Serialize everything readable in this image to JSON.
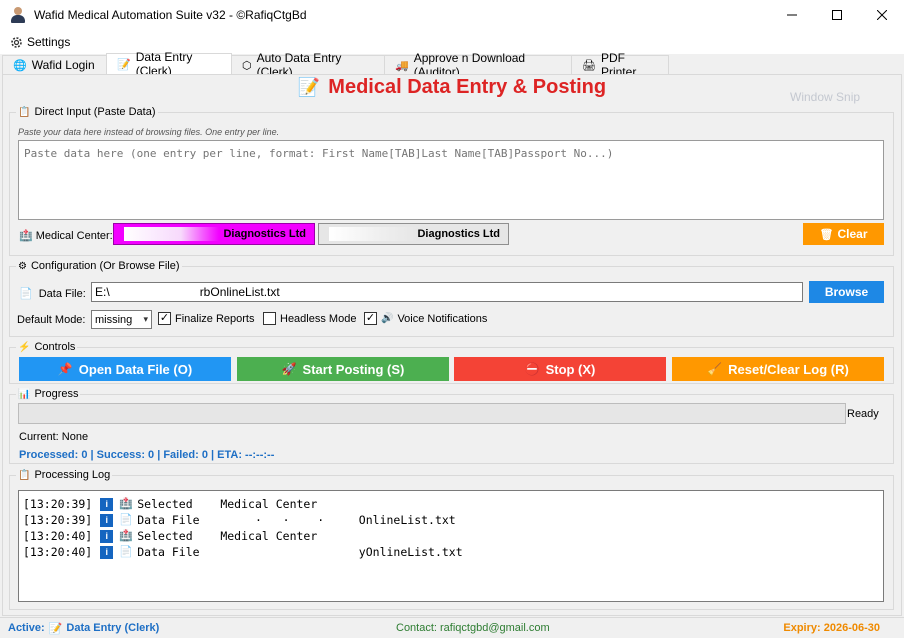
{
  "window": {
    "title": "Wafid Medical Automation Suite v32 - ©RafiqCtgBd",
    "controls": [
      "minimize-icon",
      "maximize-icon",
      "close-icon"
    ]
  },
  "menu": {
    "settings_label": "Settings"
  },
  "tabs": [
    {
      "label": "Wafid Login",
      "icon": "globe-icon",
      "active": false
    },
    {
      "label": "Data Entry (Clerk)",
      "icon": "notepad-icon",
      "active": true
    },
    {
      "label": "Auto Data Entry (Clerk)",
      "icon": "cube-icon",
      "active": false
    },
    {
      "label": "Approve n Download (Auditor)",
      "icon": "truck-icon",
      "active": false
    },
    {
      "label": "PDF Printer",
      "icon": "printer-icon",
      "active": false
    }
  ],
  "header": {
    "title": "Medical Data Entry & Posting"
  },
  "overlay": {
    "ghost_text": "Window Snip"
  },
  "direct_input": {
    "legend": "Direct Input (Paste Data)",
    "hint": "Paste your data here instead of browsing files. One entry per line.",
    "placeholder": "Paste data here (one entry per line, format: First Name[TAB]Last Name[TAB]Passport No...)",
    "medical_center_label": "Medical Center:",
    "center_1": "Diagnostics Ltd",
    "center_2": "Diagnostics Ltd",
    "clear_label": "Clear"
  },
  "config": {
    "legend": "Configuration (Or Browse File)",
    "data_file_label": "Data File:",
    "data_file_value": "E:\\                           rbOnlineList.txt",
    "browse_label": "Browse",
    "default_mode_label": "Default Mode:",
    "default_mode_value": "missing",
    "finalize_reports": {
      "label": "Finalize Reports",
      "checked": true
    },
    "headless_mode": {
      "label": "Headless Mode",
      "checked": false
    },
    "voice_notifications": {
      "label": "Voice Notifications",
      "checked": true
    }
  },
  "controls": {
    "legend": "Controls",
    "open_label": "Open Data File (O)",
    "start_label": "Start Posting (S)",
    "stop_label": "Stop (X)",
    "reset_label": "Reset/Clear Log (R)",
    "colors": {
      "open": "#2196f3",
      "start": "#4caf50",
      "stop": "#f44336",
      "reset": "#ff9800"
    }
  },
  "progress": {
    "legend": "Progress",
    "value": 0,
    "status": "Ready",
    "current": "Current: None",
    "stats": "Processed: 0 | Success: 0 | Failed: 0 | ETA: --:--:--"
  },
  "log": {
    "legend": "Processing Log",
    "lines": [
      {
        "time": "[13:20:39]",
        "icon": "hospital-icon",
        "text": "Selected    Medical Center"
      },
      {
        "time": "[13:20:39]",
        "icon": "document-icon",
        "text": "Data File        ·   ·    ·     OnlineList.txt"
      },
      {
        "time": "[13:20:40]",
        "icon": "hospital-icon",
        "text": "Selected    Medical Center"
      },
      {
        "time": "[13:20:40]",
        "icon": "document-icon",
        "text": "Data File                       yOnlineList.txt"
      }
    ]
  },
  "status_bar": {
    "active_prefix": "Active:",
    "active_tab": "Data Entry (Clerk)",
    "contact": "Contact: rafiqctgbd@gmail.com",
    "expiry": "Expiry: 2026-06-30"
  }
}
